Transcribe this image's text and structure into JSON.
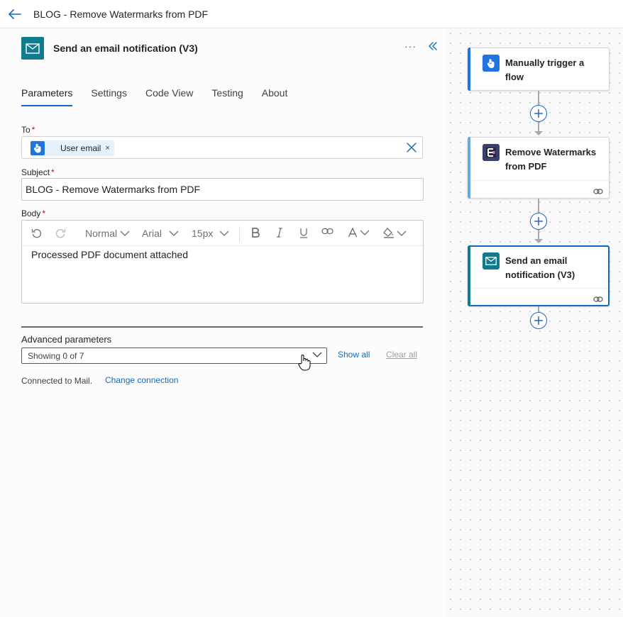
{
  "topbar": {
    "title": "BLOG - Remove Watermarks from PDF"
  },
  "panel": {
    "title": "Send an email notification (V3)",
    "more": "···",
    "tabs": [
      {
        "label": "Parameters",
        "active": true
      },
      {
        "label": "Settings"
      },
      {
        "label": "Code View"
      },
      {
        "label": "Testing"
      },
      {
        "label": "About"
      }
    ],
    "to": {
      "label": "To",
      "required": "*",
      "token": "User email",
      "token_remove": "×"
    },
    "subject": {
      "label": "Subject",
      "required": "*",
      "value": "BLOG - Remove Watermarks from PDF"
    },
    "body": {
      "label": "Body",
      "required": "*",
      "toolbar": {
        "format": "Normal",
        "font": "Arial",
        "size": "15px"
      },
      "text": "Processed PDF document attached"
    },
    "advanced": {
      "label": "Advanced parameters",
      "select_value": "Showing 0 of 7",
      "show_all": "Show all",
      "clear_all": "Clear all"
    },
    "connection": {
      "label": "Connected to Mail.",
      "change": "Change connection"
    }
  },
  "canvas": {
    "cards": [
      {
        "title": "Manually trigger a flow",
        "accent": "#1f74e0"
      },
      {
        "title": "Remove Watermarks from PDF",
        "accent": "#6aa8e0"
      },
      {
        "title": "Send an email notification (V3)",
        "accent": "#0f7b8c"
      }
    ]
  },
  "colors": {
    "brand_blue": "#0f6cbd",
    "mail_teal": "#0f7b8c",
    "trigger_blue": "#1f74e0"
  }
}
